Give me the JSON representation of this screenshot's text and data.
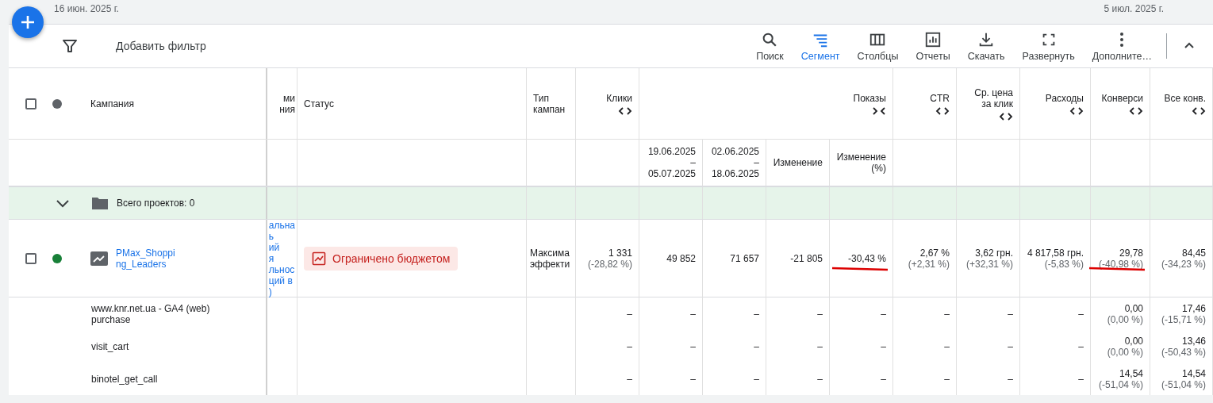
{
  "date_range": {
    "start": "16 июн. 2025 г.",
    "end": "5 июл. 2025 г."
  },
  "toolbar": {
    "filter_label": "Добавить фильтр",
    "actions": [
      {
        "label": "Поиск",
        "selected": false
      },
      {
        "label": "Сегмент",
        "selected": true
      },
      {
        "label": "Столбцы",
        "selected": false
      },
      {
        "label": "Отчеты",
        "selected": false
      },
      {
        "label": "Скачать",
        "selected": false
      },
      {
        "label": "Развернуть",
        "selected": false
      },
      {
        "label": "Дополните…",
        "selected": false
      }
    ],
    "collapsed": false
  },
  "table": {
    "header_checkbox": {
      "checked": false
    },
    "columns": [
      {
        "lines": [
          "Кампания"
        ]
      },
      {
        "lines": [
          "ми",
          "ния"
        ]
      },
      {
        "lines": [
          "Статус"
        ]
      },
      {
        "lines": [
          "Тип",
          "кампан"
        ]
      },
      {
        "lines": [
          "Клики"
        ],
        "expanded": false
      },
      {
        "lines": [
          "Показы"
        ],
        "expanded": true
      },
      {
        "lines": [
          "CTR"
        ],
        "expanded": false
      },
      {
        "lines": [
          "Ср. цена",
          "за клик"
        ],
        "expanded": false
      },
      {
        "lines": [
          "Расходы"
        ],
        "expanded": false
      },
      {
        "lines": [
          "Конверси"
        ],
        "expanded": false
      },
      {
        "lines": [
          "Все конв."
        ],
        "expanded": false
      }
    ],
    "subcolumns": [
      {
        "lines": [
          "19.06.2025",
          "–",
          "05.07.2025"
        ]
      },
      {
        "lines": [
          "02.06.2025",
          "–",
          "18.06.2025"
        ]
      },
      {
        "lines": [
          "Изменение"
        ]
      },
      {
        "lines": [
          "Изменение",
          "(%)"
        ]
      }
    ],
    "group_row": {
      "expanded": true,
      "label": "Всего проектов: 0"
    },
    "campaign": {
      "checked": false,
      "enabled": true,
      "name_lines": [
        "PMax_Shoppi",
        "ng_Leaders"
      ],
      "clipped_lines": [
        "альна",
        "ь",
        "ий",
        "я",
        "льнос",
        "ций в",
        ")"
      ],
      "status": "Ограничено бюджетом",
      "type_lines": [
        "Максима",
        "эффекти"
      ],
      "metrics": [
        {
          "value": "1 331",
          "change": "(-28,82 %)",
          "underlined": false
        },
        {
          "value": "49 852",
          "underlined": false
        },
        {
          "value": "71 657",
          "underlined": false
        },
        {
          "value": "-21 805",
          "underlined": false
        },
        {
          "value": "-30,43 %",
          "underlined": true
        },
        {
          "value": "2,67 %",
          "change": "(+2,31 %)",
          "underlined": false
        },
        {
          "value": "3,62 грн.",
          "change": "(+32,31 %)",
          "underlined": false
        },
        {
          "value": "4 817,58 грн.",
          "change": "(-5,83 %)",
          "underlined": false
        },
        {
          "value": "29,78",
          "change": "(-40,98 %)",
          "underlined": true
        },
        {
          "value": "84,45",
          "change": "(-34,23 %)",
          "underlined": false
        }
      ]
    },
    "conversion_rows": [
      {
        "name_lines": [
          "www.knr.net.ua - GA4 (web)",
          "purchase"
        ],
        "metrics": [
          {
            "value": "–"
          },
          {
            "value": "–"
          },
          {
            "value": "–"
          },
          {
            "value": "–"
          },
          {
            "value": "–"
          },
          {
            "value": "–"
          },
          {
            "value": "–"
          },
          {
            "value": "–"
          },
          {
            "value": "0,00",
            "change": "(0,00 %)"
          },
          {
            "value": "17,46",
            "change": "(-15,71 %)"
          }
        ]
      },
      {
        "name_lines": [
          "visit_cart"
        ],
        "metrics": [
          {
            "value": "–"
          },
          {
            "value": "–"
          },
          {
            "value": "–"
          },
          {
            "value": "–"
          },
          {
            "value": "–"
          },
          {
            "value": "–"
          },
          {
            "value": "–"
          },
          {
            "value": "–"
          },
          {
            "value": "0,00",
            "change": "(0,00 %)"
          },
          {
            "value": "13,46",
            "change": "(-50,43 %)"
          }
        ]
      },
      {
        "name_lines": [
          "binotel_get_call"
        ],
        "metrics": [
          {
            "value": "–"
          },
          {
            "value": "–"
          },
          {
            "value": "–"
          },
          {
            "value": "–"
          },
          {
            "value": "–"
          },
          {
            "value": "–"
          },
          {
            "value": "–"
          },
          {
            "value": "–"
          },
          {
            "value": "14,54",
            "change": "(-51,04 %)"
          },
          {
            "value": "14,54",
            "change": "(-51,04 %)"
          }
        ]
      }
    ]
  }
}
